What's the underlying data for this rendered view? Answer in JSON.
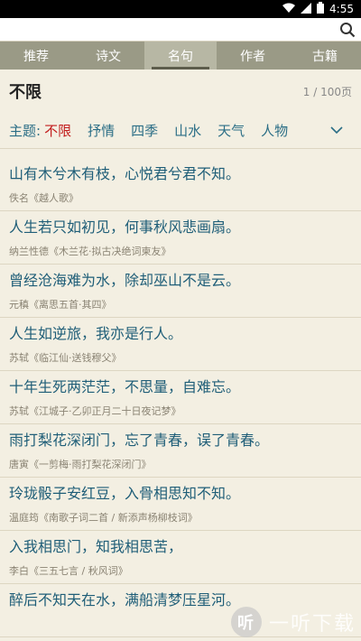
{
  "status": {
    "time": "4:55"
  },
  "search": {
    "placeholder": ""
  },
  "tabs": [
    "推荐",
    "诗文",
    "名句",
    "作者",
    "古籍"
  ],
  "header": {
    "title": "不限",
    "pages": "1 / 100页"
  },
  "topics": {
    "label": "主题:",
    "chips": [
      "不限",
      "抒情",
      "四季",
      "山水",
      "天气",
      "人物"
    ]
  },
  "quotes": [
    {
      "verse": "山有木兮木有枝，心悦君兮君不知。",
      "source": "佚名《越人歌》"
    },
    {
      "verse": "人生若只如初见，何事秋风悲画扇。",
      "source": "纳兰性德《木兰花·拟古决绝词柬友》"
    },
    {
      "verse": "曾经沧海难为水，除却巫山不是云。",
      "source": "元稹《离思五首·其四》"
    },
    {
      "verse": "人生如逆旅，我亦是行人。",
      "source": "苏轼《临江仙·送钱穆父》"
    },
    {
      "verse": "十年生死两茫茫，不思量，自难忘。",
      "source": "苏轼《江城子·乙卯正月二十日夜记梦》"
    },
    {
      "verse": "雨打梨花深闭门，忘了青春，误了青春。",
      "source": "唐寅《一剪梅·雨打梨花深闭门》"
    },
    {
      "verse": "玲珑骰子安红豆，入骨相思知不知。",
      "source": "温庭筠《南歌子词二首 / 新添声杨柳枝词》"
    },
    {
      "verse": "入我相思门，知我相思苦，",
      "source": "李白《三五七言 / 秋风词》"
    },
    {
      "verse": "醉后不知天在水，满船清梦压星河。",
      "source": ""
    }
  ],
  "watermark": {
    "logo": "听",
    "text": "一听下载"
  }
}
